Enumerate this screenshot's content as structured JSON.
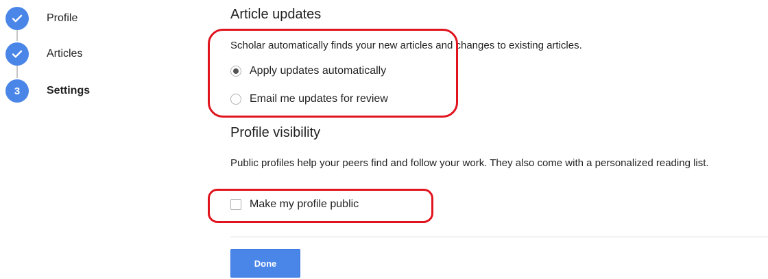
{
  "stepper": {
    "steps": [
      {
        "label": "Profile",
        "state": "completed"
      },
      {
        "label": "Articles",
        "state": "completed"
      },
      {
        "label": "Settings",
        "state": "current",
        "number": "3"
      }
    ]
  },
  "article_updates": {
    "title": "Article updates",
    "description": "Scholar automatically finds your new articles and changes to existing articles.",
    "options": [
      {
        "label": "Apply updates automatically",
        "selected": true
      },
      {
        "label": "Email me updates for review",
        "selected": false
      }
    ]
  },
  "profile_visibility": {
    "title": "Profile visibility",
    "description": "Public profiles help your peers find and follow your work. They also come with a personalized reading list.",
    "checkbox": {
      "label": "Make my profile public",
      "checked": false
    }
  },
  "actions": {
    "done_label": "Done"
  },
  "colors": {
    "accent": "#4a86e8",
    "annotation": "#e0141e"
  }
}
